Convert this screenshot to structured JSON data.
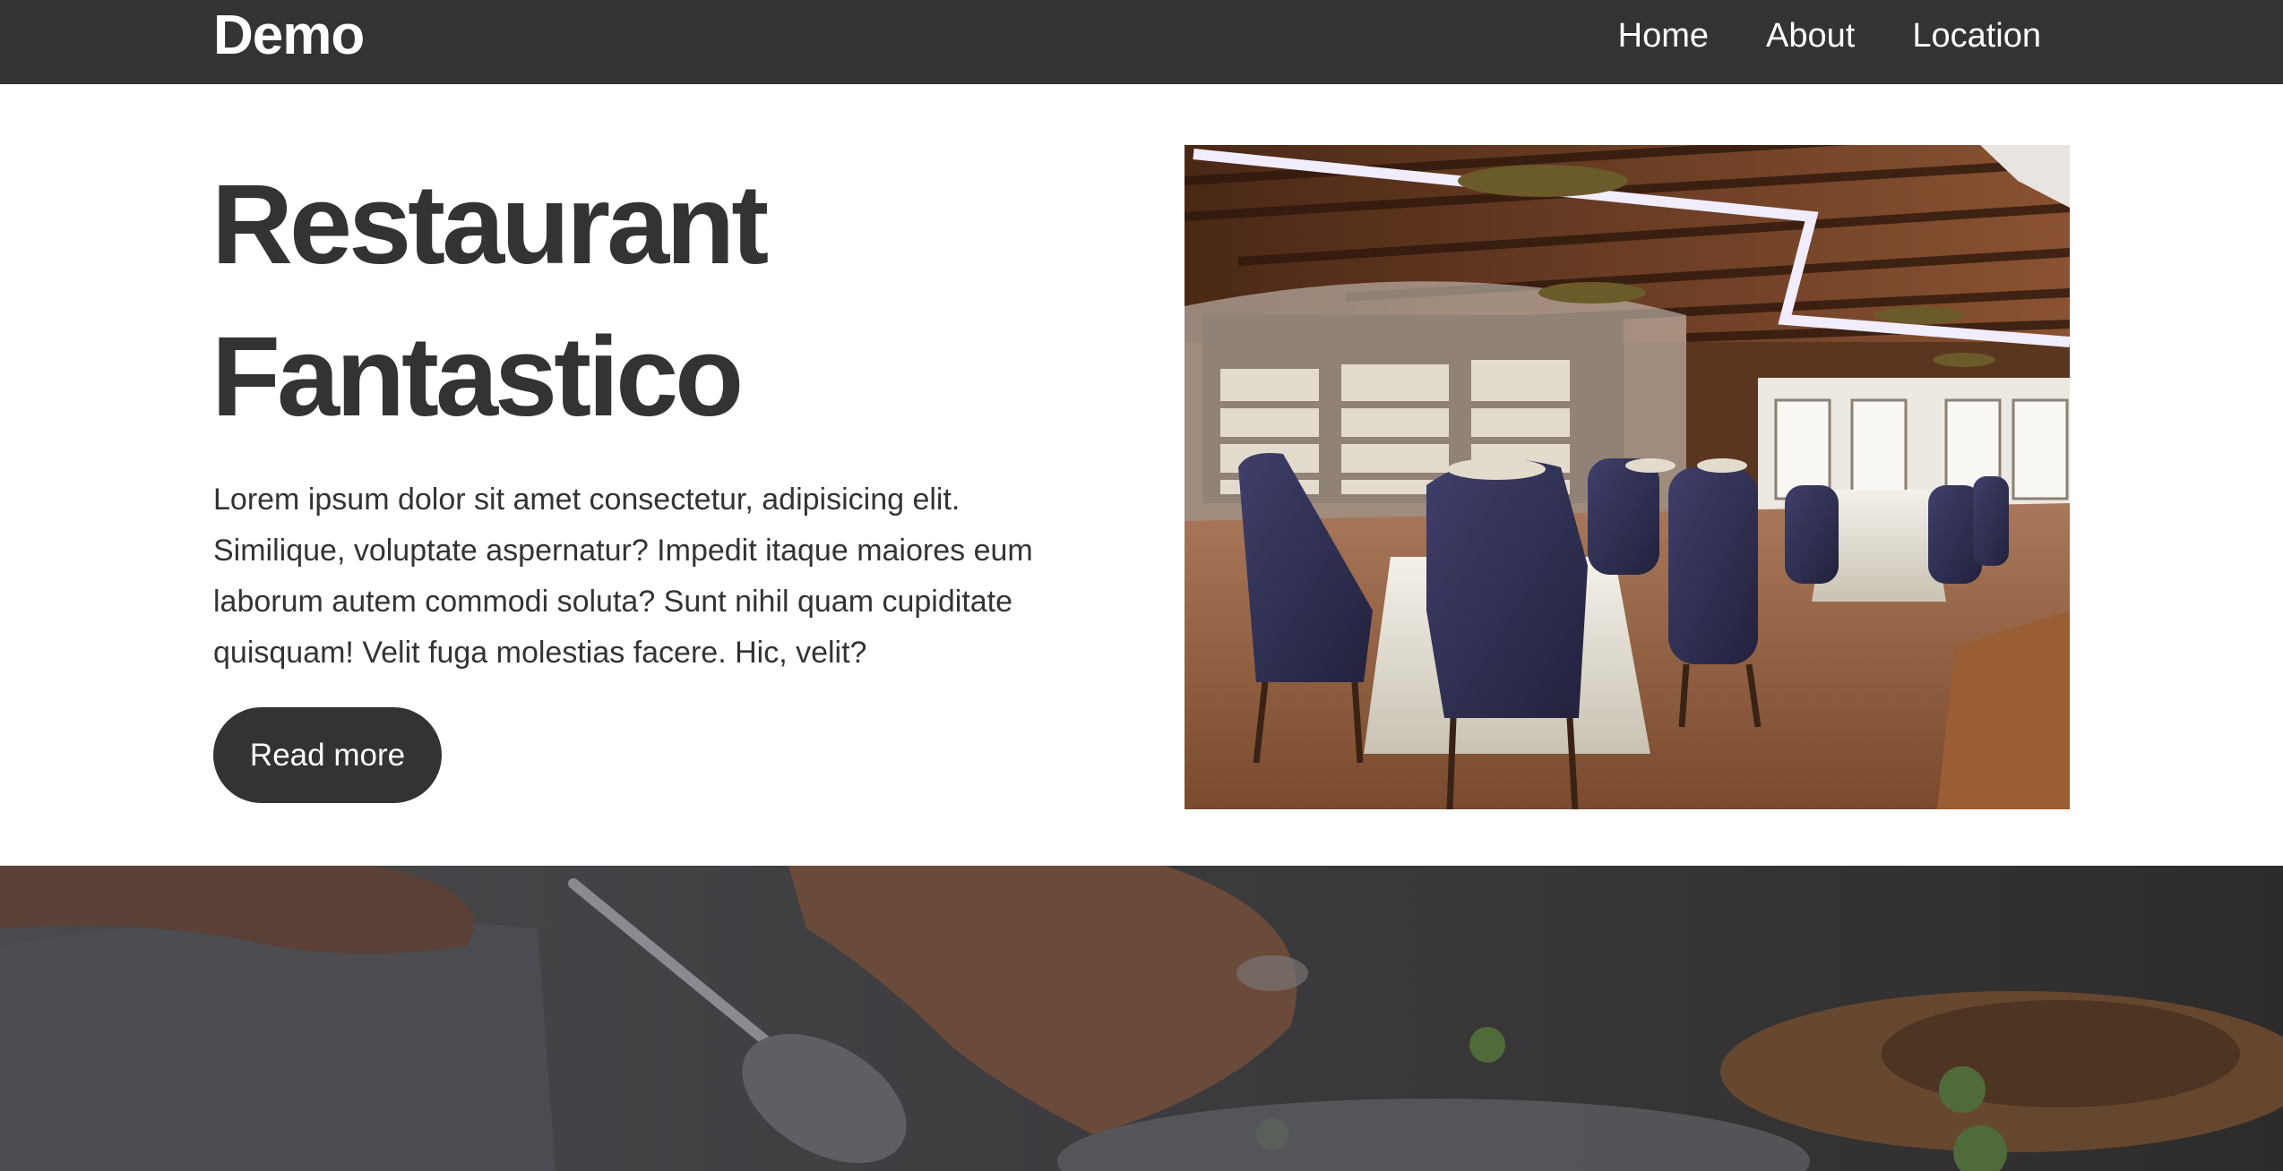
{
  "nav": {
    "brand": "Demo",
    "links": [
      {
        "label": "Home"
      },
      {
        "label": "About"
      },
      {
        "label": "Location"
      }
    ]
  },
  "hero": {
    "title_line1": "Restaurant",
    "title_line2": "Fantastico",
    "text": "Lorem ipsum dolor sit amet consectetur, adipisicing elit. Similique, voluptate aspernatur? Impedit itaque maiores eum laborum autem commodi soluta? Sunt nihil quam cupiditate quisquam! Velit fuga molestias facere. Hic, velit?",
    "button_label": "Read more"
  },
  "colors": {
    "navbar": "#333333",
    "button": "#333333",
    "text": "#333333"
  }
}
